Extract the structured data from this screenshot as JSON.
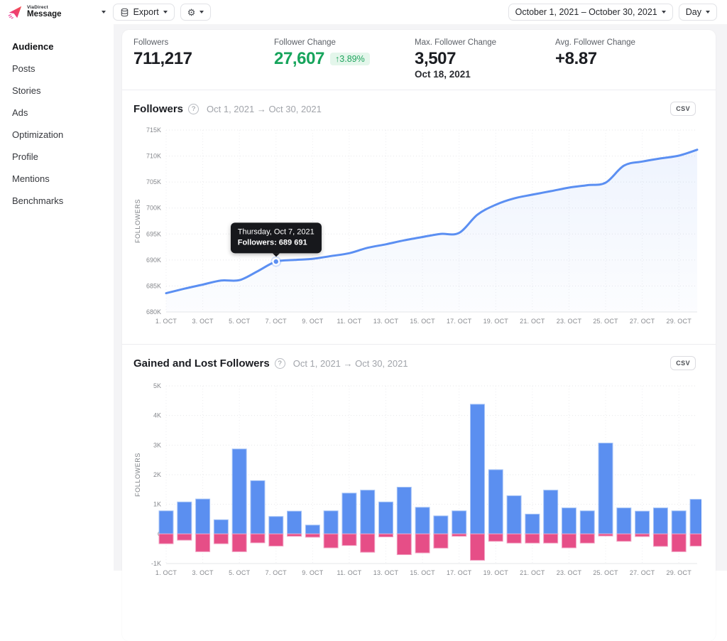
{
  "header": {
    "brand_top": "ViaDirect",
    "brand_bottom": "Message",
    "export_label": "Export",
    "date_range": "October 1, 2021 – October 30, 2021",
    "granularity": "Day"
  },
  "sidebar": {
    "items": [
      {
        "label": "Audience",
        "active": true
      },
      {
        "label": "Posts",
        "active": false
      },
      {
        "label": "Stories",
        "active": false
      },
      {
        "label": "Ads",
        "active": false
      },
      {
        "label": "Optimization",
        "active": false
      },
      {
        "label": "Profile",
        "active": false
      },
      {
        "label": "Mentions",
        "active": false
      },
      {
        "label": "Benchmarks",
        "active": false
      }
    ]
  },
  "stats": {
    "followers": {
      "label": "Followers",
      "value": "711,217"
    },
    "change": {
      "label": "Follower Change",
      "value": "27,607",
      "badge": "↑3.89%"
    },
    "max_change": {
      "label": "Max. Follower Change",
      "value": "3,507",
      "date": "Oct 18, 2021"
    },
    "avg_change": {
      "label": "Avg. Follower Change",
      "value": "+8.87"
    }
  },
  "sections": {
    "followers_chart": {
      "title": "Followers",
      "date_range": "Oct 1, 2021 → Oct 30, 2021",
      "csv_label": "CSV"
    },
    "gained_lost_chart": {
      "title": "Gained and Lost Followers",
      "date_range": "Oct 1, 2021 → Oct 30, 2021",
      "csv_label": "CSV"
    }
  },
  "colors": {
    "line_blue": "#5b8ff2",
    "bar_blue": "#5b8ff0",
    "bar_pink": "#e64e87",
    "green": "#17a45c",
    "axis_text": "#97999e",
    "grid": "#e4e5e9"
  },
  "chart_data": [
    {
      "type": "line",
      "title": "Followers",
      "date_range": "Oct 1, 2021 → Oct 30, 2021",
      "ylabel": "FOLLOWERS",
      "x": [
        1,
        2,
        3,
        4,
        5,
        6,
        7,
        8,
        9,
        10,
        11,
        12,
        13,
        14,
        15,
        16,
        17,
        18,
        19,
        20,
        21,
        22,
        23,
        24,
        25,
        26,
        27,
        28,
        29,
        30
      ],
      "values": [
        683610,
        684480,
        685270,
        686060,
        686130,
        687850,
        689691,
        690010,
        690220,
        690760,
        691310,
        692350,
        693020,
        693780,
        694430,
        695020,
        695210,
        698717,
        700630,
        701850,
        702570,
        703240,
        703920,
        704390,
        704870,
        708150,
        708940,
        709540,
        710080,
        711217
      ],
      "ylim": [
        680000,
        715000
      ],
      "y_tick_step": 5000,
      "x_tick_labels": [
        "1. OCT",
        "3. OCT",
        "5. OCT",
        "7. OCT",
        "9. OCT",
        "11. OCT",
        "13. OCT",
        "15. OCT",
        "17. OCT",
        "19. OCT",
        "21. OCT",
        "23. OCT",
        "25. OCT",
        "27. OCT",
        "29. OCT"
      ],
      "line_color": "#5b8ff2",
      "grid": true,
      "tooltip": {
        "day": 7,
        "title": "Thursday, Oct 7, 2021",
        "label": "Followers: 689 691"
      }
    },
    {
      "type": "bar",
      "title": "Gained and Lost Followers",
      "date_range": "Oct 1, 2021 → Oct 30, 2021",
      "ylabel": "FOLLOWERS",
      "x": [
        1,
        2,
        3,
        4,
        5,
        6,
        7,
        8,
        9,
        10,
        11,
        12,
        13,
        14,
        15,
        16,
        17,
        18,
        19,
        20,
        21,
        22,
        23,
        24,
        25,
        26,
        27,
        28,
        29,
        30
      ],
      "series": [
        {
          "name": "Gained",
          "color": "#5b8ff0",
          "values": [
            780,
            1080,
            1180,
            480,
            2870,
            1800,
            590,
            770,
            300,
            780,
            1380,
            1480,
            1080,
            1580,
            900,
            610,
            780,
            4380,
            2170,
            1290,
            670,
            1480,
            880,
            780,
            3070,
            880,
            770,
            880,
            780,
            1170
          ]
        },
        {
          "name": "Lost",
          "color": "#e64e87",
          "values": [
            -330,
            -210,
            -600,
            -330,
            -600,
            -300,
            -410,
            -80,
            -110,
            -470,
            -390,
            -620,
            -100,
            -700,
            -640,
            -480,
            -80,
            -890,
            -250,
            -310,
            -310,
            -310,
            -470,
            -310,
            -70,
            -250,
            -90,
            -420,
            -600,
            -410
          ]
        }
      ],
      "ylim": [
        -1000,
        5000
      ],
      "y_tick_step": 1000,
      "x_tick_labels": [
        "1. OCT",
        "3. OCT",
        "5. OCT",
        "7. OCT",
        "9. OCT",
        "11. OCT",
        "13. OCT",
        "15. OCT",
        "17. OCT",
        "19. OCT",
        "21. OCT",
        "23. OCT",
        "25. OCT",
        "27. OCT",
        "29. OCT"
      ],
      "grid": true
    }
  ]
}
